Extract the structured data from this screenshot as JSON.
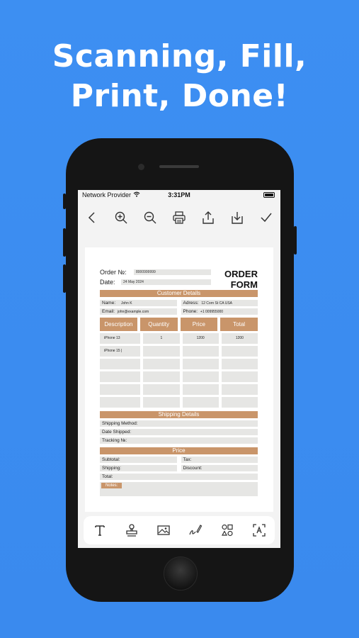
{
  "headline": {
    "line1": "Scanning, Fill,",
    "line2": "Print, Done!"
  },
  "status": {
    "carrier": "Network Provider",
    "time": "3:31PM"
  },
  "toolbar": [
    "back-icon",
    "zoom-in-icon",
    "zoom-out-icon",
    "print-icon",
    "share-icon",
    "download-icon",
    "checkmark-icon"
  ],
  "form": {
    "title_line1": "ORDER",
    "title_line2": "FORM",
    "order_no_label": "Order №:",
    "order_no_value": "8000999999",
    "date_label": "Date:",
    "date_value": "24 May 2024",
    "customer_section": "Customer Details",
    "name_label": "Name:",
    "name_value": "John K",
    "address_label": "Adress:",
    "address_value": "12 Corn St CA USA",
    "email_label": "Email:",
    "email_value": "john@example.com",
    "phone_label": "Phone:",
    "phone_value": "+1 009955000",
    "columns": [
      "Description",
      "Quantity",
      "Price",
      "Total"
    ],
    "rows": [
      [
        "iPhone 13",
        "1",
        "1200",
        "1200"
      ],
      [
        "iPhone 15 |",
        "",
        "",
        ""
      ],
      [
        "",
        "",
        "",
        ""
      ],
      [
        "",
        "",
        "",
        ""
      ],
      [
        "",
        "",
        "",
        ""
      ],
      [
        "",
        "",
        "",
        ""
      ]
    ],
    "shipping_section": "Shipping Details",
    "shipping_method_label": "Shipping Method:",
    "date_shipped_label": "Date Shipped:",
    "tracking_label": "Tracking №:",
    "price_section": "Price",
    "subtotal_label": "Subtotal:",
    "tax_label": "Tax:",
    "shipping_label": "Shipping:",
    "discount_label": "Discount:",
    "total_label": "Total:",
    "notes_label": "Notes:"
  },
  "bottom_tools": [
    "text-icon",
    "stamp-icon",
    "image-icon",
    "signature-icon",
    "shapes-icon",
    "text-recognition-icon"
  ],
  "colors": {
    "background": "#3b8cf0",
    "accent": "#c9956a",
    "field": "#e6e6e4"
  }
}
